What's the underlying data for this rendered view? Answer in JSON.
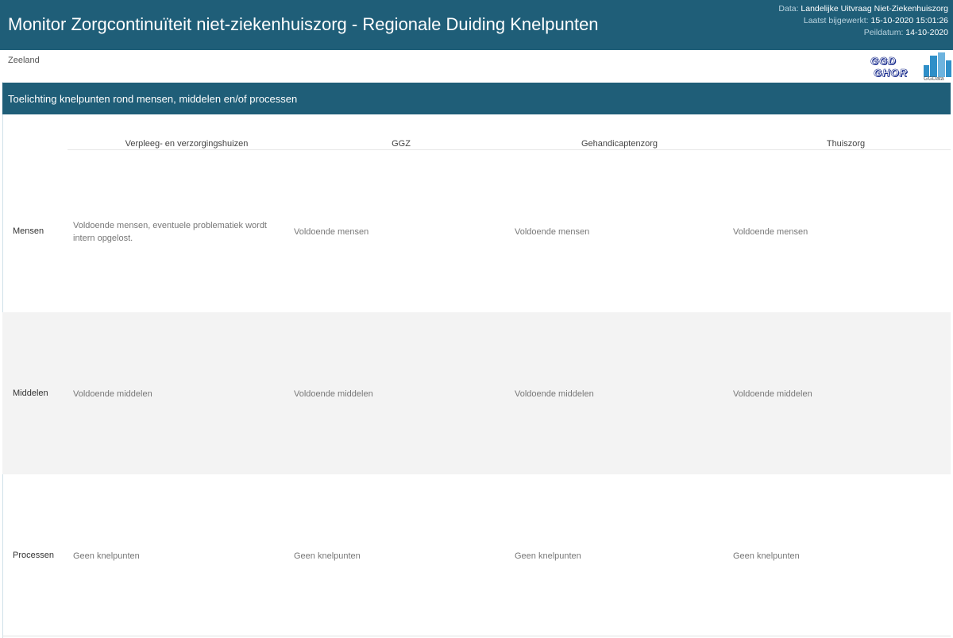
{
  "header": {
    "title": "Monitor Zorgcontinuïteit niet-ziekenhuiszorg - Regionale Duiding Knelpunten",
    "data_label": "Data: ",
    "data_value": "Landelijke Uitvraag Niet-Ziekenhuiszorg",
    "updated_label": "Laatst bijgewerkt: ",
    "updated_value": "15-10-2020 15:01:26",
    "peildatum_label": "Peildatum: ",
    "peildatum_value": "14-10-2020"
  },
  "region": "Zeeland",
  "logos": {
    "ggd_top": "GGD",
    "ggd_bottom": "GHOR",
    "ggdata_caption": "GGData"
  },
  "section": {
    "title": "Toelichting knelpunten rond mensen, middelen en/of processen"
  },
  "table": {
    "columns": [
      "Verpleeg- en verzorgingshuizen",
      "GGZ",
      "Gehandicaptenzorg",
      "Thuiszorg"
    ],
    "rows": [
      {
        "label": "Mensen",
        "cells": [
          "Voldoende mensen, eventuele problematiek wordt intern opgelost.",
          "Voldoende mensen",
          "Voldoende mensen",
          "Voldoende mensen"
        ]
      },
      {
        "label": "Middelen",
        "cells": [
          "Voldoende middelen",
          "Voldoende middelen",
          "Voldoende middelen",
          "Voldoende middelen"
        ]
      },
      {
        "label": "Processen",
        "cells": [
          "Geen knelpunten",
          "Geen knelpunten",
          "Geen knelpunten",
          "Geen knelpunten"
        ]
      }
    ]
  },
  "colors": {
    "header_bg": "#1f5e78",
    "band_bg": "#f3f3f3",
    "logo_blue": "#1c2f8f",
    "ggdata_blue": "#2f8fc8"
  }
}
